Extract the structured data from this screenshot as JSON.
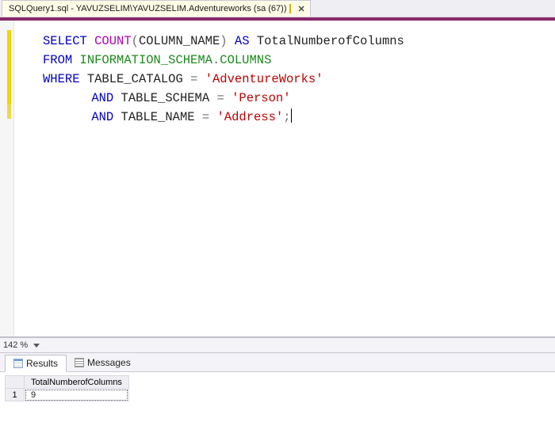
{
  "tab": {
    "title": "SQLQuery1.sql - YAVUZSELIM\\YAVUZSELIM.Adventureworks (sa (67))"
  },
  "code": {
    "line1": {
      "select": "SELECT",
      "count": "COUNT",
      "lp": "(",
      "arg": "COLUMN_NAME",
      "rp": ")",
      "as": "AS",
      "alias": "TotalNumberofColumns"
    },
    "line2": {
      "from": "FROM",
      "src": "INFORMATION_SCHEMA",
      "dot": ".",
      "obj": "COLUMNS"
    },
    "line3": {
      "where": "WHERE",
      "col": "TABLE_CATALOG",
      "eq": "=",
      "val": "'AdventureWorks'"
    },
    "line4": {
      "and": "AND",
      "col": "TABLE_SCHEMA",
      "eq": "=",
      "val": "'Person'"
    },
    "line5": {
      "and": "AND",
      "col": "TABLE_NAME",
      "eq": "=",
      "val": "'Address'",
      "semi": ";"
    }
  },
  "zoom": {
    "value": "142 %"
  },
  "resultTabs": {
    "results": "Results",
    "messages": "Messages"
  },
  "grid": {
    "header": "TotalNumberofColumns",
    "rows": [
      {
        "n": "1",
        "v": "9"
      }
    ]
  }
}
